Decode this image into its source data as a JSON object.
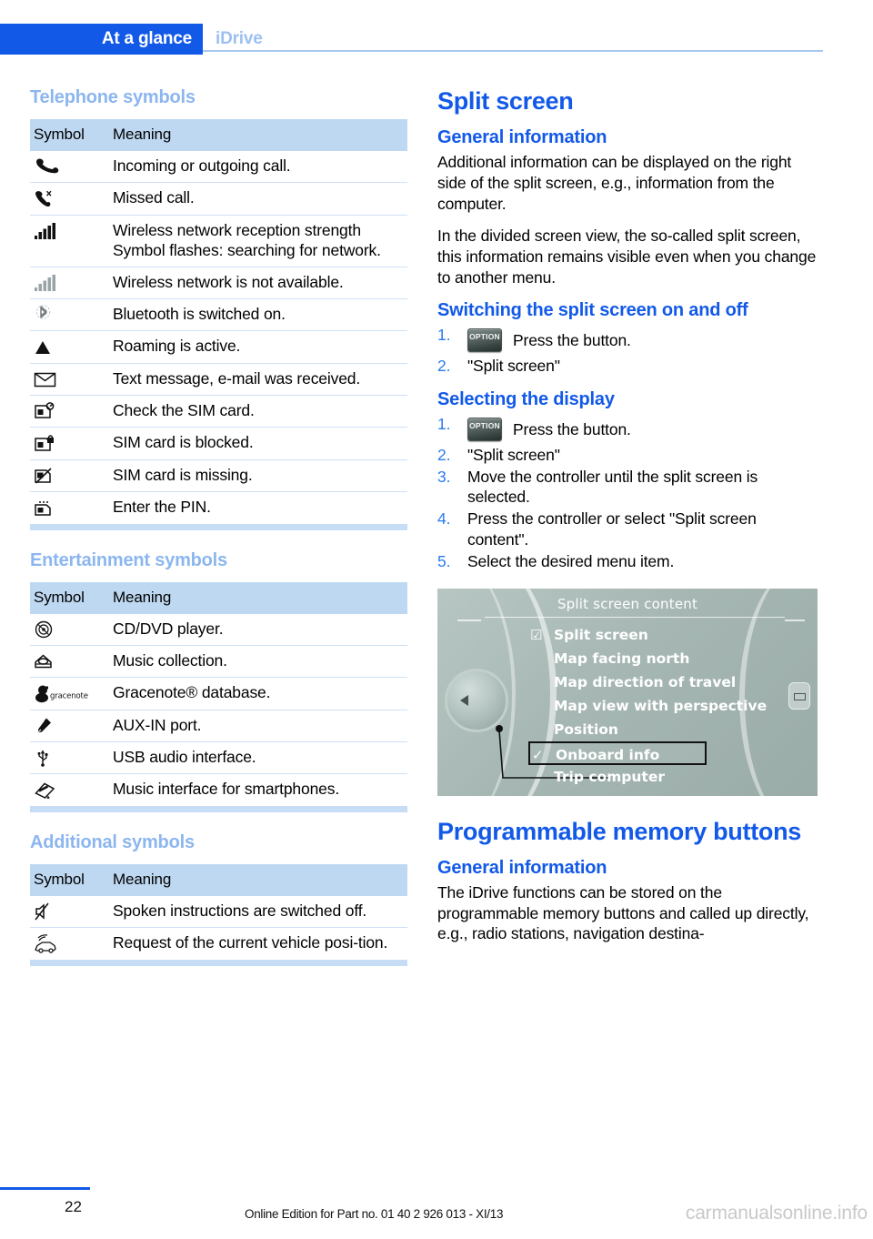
{
  "header": {
    "tab_label": "At a glance",
    "sub_label": "iDrive"
  },
  "left_column": {
    "telephone": {
      "heading": "Telephone symbols",
      "columns": {
        "symbol": "Symbol",
        "meaning": "Meaning"
      },
      "rows": [
        {
          "icon": "phone-handset-icon",
          "meaning": "Incoming or outgoing call."
        },
        {
          "icon": "missed-call-icon",
          "meaning": "Missed call."
        },
        {
          "icon": "signal-bars-full-icon",
          "meaning": "Wireless network reception strength Symbol flashes: searching for network."
        },
        {
          "icon": "signal-bars-gray-icon",
          "meaning": "Wireless network is not available."
        },
        {
          "icon": "bluetooth-icon",
          "meaning": "Bluetooth is switched on."
        },
        {
          "icon": "roaming-triangle-icon",
          "meaning": "Roaming is active."
        },
        {
          "icon": "envelope-icon",
          "meaning": "Text message, e-mail was received."
        },
        {
          "icon": "sim-check-icon",
          "meaning": "Check the SIM card."
        },
        {
          "icon": "sim-locked-icon",
          "meaning": "SIM card is blocked."
        },
        {
          "icon": "sim-missing-icon",
          "meaning": "SIM card is missing."
        },
        {
          "icon": "sim-pin-icon",
          "meaning": "Enter the PIN."
        }
      ]
    },
    "entertainment": {
      "heading": "Entertainment symbols",
      "columns": {
        "symbol": "Symbol",
        "meaning": "Meaning"
      },
      "rows": [
        {
          "icon": "cd-dvd-icon",
          "meaning": "CD/DVD player."
        },
        {
          "icon": "music-collection-icon",
          "meaning": "Music collection."
        },
        {
          "icon": "gracenote-icon",
          "icon_text": "gracenote",
          "meaning": "Gracenote® database."
        },
        {
          "icon": "aux-in-plug-icon",
          "meaning": "AUX-IN port."
        },
        {
          "icon": "usb-icon",
          "meaning": "USB audio interface."
        },
        {
          "icon": "smartphone-music-interface-icon",
          "meaning": "Music interface for smartphones."
        }
      ]
    },
    "additional": {
      "heading": "Additional symbols",
      "columns": {
        "symbol": "Symbol",
        "meaning": "Meaning"
      },
      "rows": [
        {
          "icon": "speaker-muted-icon",
          "meaning": "Spoken instructions are switched off."
        },
        {
          "icon": "vehicle-position-icon",
          "meaning": "Request of the current vehicle posi-tion."
        }
      ]
    }
  },
  "right_column": {
    "split_screen": {
      "title": "Split screen",
      "general_info": {
        "heading": "General information",
        "paragraphs": [
          "Additional information can be displayed on the right side of the split screen, e.g., information from the computer.",
          "In the divided screen view, the so-called split screen, this information remains visible even when you change to another menu."
        ]
      },
      "switching": {
        "heading": "Switching the split screen on and off",
        "steps": [
          {
            "button_label": "OPTION",
            "text": "Press the button."
          },
          {
            "text": "\"Split screen\""
          }
        ]
      },
      "selecting": {
        "heading": "Selecting the display",
        "steps": [
          {
            "button_label": "OPTION",
            "text": "Press the button."
          },
          {
            "text": "\"Split screen\""
          },
          {
            "text": "Move the controller until the split screen is selected."
          },
          {
            "text": "Press the controller or select \"Split screen content\"."
          },
          {
            "text": "Select the desired menu item."
          }
        ]
      },
      "idrive_screen": {
        "title": "Split screen content",
        "items": [
          {
            "label": "Split screen",
            "mark": "checkbox-checked",
            "selected": false
          },
          {
            "label": "Map facing north",
            "mark": "",
            "selected": false
          },
          {
            "label": "Map direction of travel",
            "mark": "",
            "selected": false
          },
          {
            "label": "Map view with perspective",
            "mark": "",
            "selected": false
          },
          {
            "label": "Position",
            "mark": "",
            "selected": false
          },
          {
            "label": "Onboard info",
            "mark": "check",
            "selected": true
          },
          {
            "label": "Trip computer",
            "mark": "",
            "selected": false
          }
        ]
      }
    },
    "memory_buttons": {
      "title": "Programmable memory buttons",
      "general_info": {
        "heading": "General information",
        "paragraphs": [
          "The iDrive functions can be stored on the programmable memory buttons and called up directly, e.g., radio stations, navigation destina-"
        ]
      }
    }
  },
  "footer": {
    "page_number": "22",
    "note": "Online Edition for Part no. 01 40 2 926 013 - XI/13",
    "watermark": "carmanualsonline.info"
  },
  "colors": {
    "brand_blue": "#1259e8",
    "light_blue": "#8cb6ef",
    "table_header_bg": "#bed8f2",
    "table_rule": "#cfe0f5",
    "idrive_bg": "#a6b7b3"
  }
}
